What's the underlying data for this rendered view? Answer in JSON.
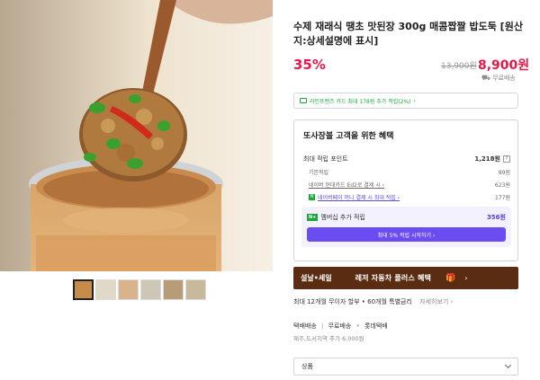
{
  "product": {
    "title": "수제 재래식 땡초 맛된장 300g 매콤짭짤 밥도둑 [원산지:상세설명에 표시]",
    "discount": "35%",
    "original_price": "13,900원",
    "sale_price": "8,900원",
    "delivery_badge": "무료배송"
  },
  "card_promo": {
    "text": "라인프렌즈 카드 최대 178원 추가 적립(2%)",
    "arrow": "›"
  },
  "benefit": {
    "title": "또사장볼 고객을 위한 혜택",
    "max_points_label": "최대 적립 포인트",
    "max_points_value": "1,218원",
    "rows": [
      {
        "label": "기본적립",
        "value": "89원"
      },
      {
        "label": "네이버 현대카드 Ed2로 결제 시 ›",
        "value": "623원"
      },
      {
        "label": "네이버페이 머니 결제 시 최대 적립 ›",
        "value": "177원"
      }
    ],
    "membership_badge": "N+",
    "membership_label": "멤버십 추가 적립",
    "membership_value": "356원",
    "membership_button": "최대 5% 적립 시작하기 ›"
  },
  "banner": {
    "event": "설날•세일",
    "promo": "레저 자동차 플러스 혜택",
    "arrow": "›"
  },
  "installment": {
    "text": "최대 12개월 무이자 할부 • 60개월 특별금리",
    "more": "자세히보기 ›"
  },
  "shipping": {
    "label": "택배배송",
    "fee": "무료배송",
    "carrier": "롯데택배",
    "extra": "제주,도서지역 추가 6,000원"
  },
  "option": {
    "label": "상품"
  },
  "colors": {
    "accent_red": "#e8194a",
    "naver_green": "#1ea83c",
    "membership_purple": "#6b4cf0",
    "banner_brown": "#5a2d12"
  }
}
